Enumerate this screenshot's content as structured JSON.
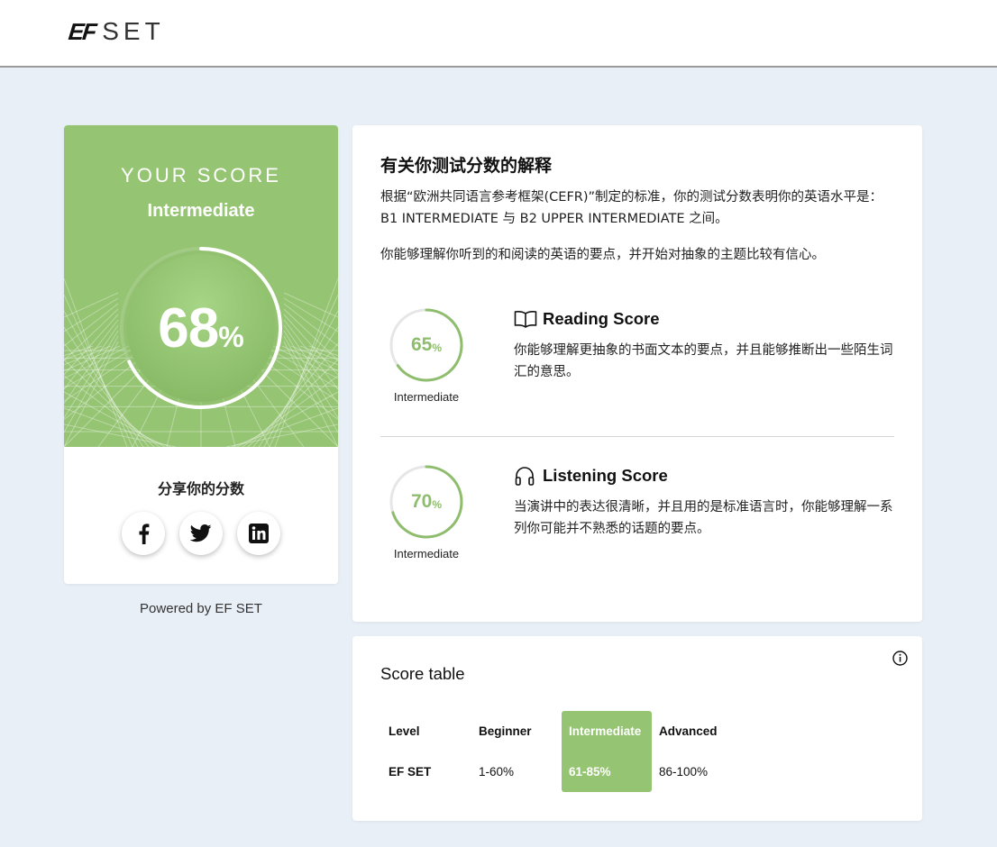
{
  "header": {
    "logo_ef": "EF",
    "logo_set": "SET"
  },
  "score_card": {
    "heading": "YOUR SCORE",
    "level": "Intermediate",
    "score": "68",
    "score_fraction": 0.68,
    "percent_sign": "%",
    "share_title": "分享你的分数",
    "share_buttons": [
      "facebook-icon",
      "twitter-icon",
      "linkedin-icon"
    ]
  },
  "powered_by": "Powered by EF SET",
  "explanation": {
    "title": "有关你测试分数的解释",
    "p1": "根据“欧洲共同语言参考框架(CEFR)”制定的标准，你的测试分数表明你的英语水平是：B1 INTERMEDIATE 与 B2 UPPER INTERMEDIATE 之间。",
    "p2": "你能够理解你听到的和阅读的英语的要点，并开始对抽象的主题比较有信心。",
    "reading": {
      "title": "Reading Score",
      "score": "65",
      "score_fraction": 0.65,
      "percent_sign": "%",
      "level": "Intermediate",
      "icon": "book-icon",
      "description": "你能够理解更抽象的书面文本的要点，并且能够推断出一些陌生词汇的意思。"
    },
    "listening": {
      "title": "Listening Score",
      "score": "70",
      "score_fraction": 0.7,
      "percent_sign": "%",
      "level": "Intermediate",
      "icon": "headphones-icon",
      "description": "当演讲中的表达很清晰，并且用的是标准语言时，你能够理解一系列你可能并不熟悉的话题的要点。"
    }
  },
  "score_table": {
    "title": "Score table",
    "info_icon": "info-icon",
    "headers": [
      "Level",
      "Beginner",
      "Intermediate",
      "Advanced"
    ],
    "row": [
      "EF SET",
      "1-60%",
      "61-85%",
      "86-100%"
    ],
    "highlighted_column": "Intermediate"
  },
  "colors": {
    "accent_green": "#95c473",
    "ring_green": "#8fbd6e",
    "background": "#e8eff7"
  }
}
